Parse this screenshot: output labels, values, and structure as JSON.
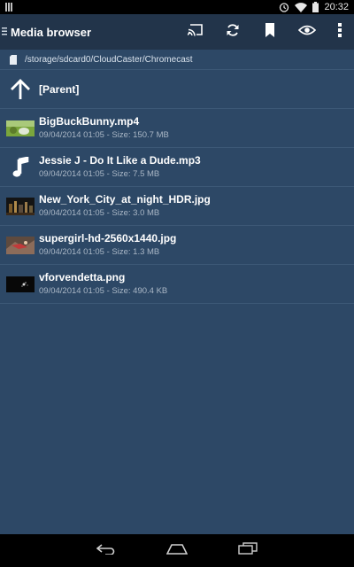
{
  "status_bar": {
    "time": "20:32",
    "icons": [
      "notification-icon",
      "alarm-icon",
      "wifi-icon",
      "battery-icon"
    ]
  },
  "action_bar": {
    "title": "Media browser",
    "actions": [
      "cast-icon",
      "refresh-icon",
      "bookmark-icon",
      "eye-icon",
      "overflow-menu-icon"
    ]
  },
  "path": {
    "text": "/storage/sdcard0/CloudCaster/Chromecast"
  },
  "parent": {
    "label": "[Parent]"
  },
  "files": [
    {
      "name": "BigBuckBunny.mp4",
      "meta": "09/04/2014 01:05 - Size: 150.7 MB",
      "type": "video"
    },
    {
      "name": "Jessie J - Do It Like a Dude.mp3",
      "meta": "09/04/2014 01:05 - Size: 7.5 MB",
      "type": "audio"
    },
    {
      "name": "New_York_City_at_night_HDR.jpg",
      "meta": "09/04/2014 01:05 - Size: 3.0 MB",
      "type": "image"
    },
    {
      "name": "supergirl-hd-2560x1440.jpg",
      "meta": "09/04/2014 01:05 - Size: 1.3 MB",
      "type": "image"
    },
    {
      "name": "vforvendetta.png",
      "meta": "09/04/2014 01:05 - Size: 490.4 KB",
      "type": "image"
    }
  ],
  "nav_bar": {
    "buttons": [
      "back-icon",
      "home-icon",
      "recents-icon"
    ]
  },
  "colors": {
    "background": "#2d4866",
    "action_bar": "#22344a",
    "divider": "#3c5876",
    "meta_text": "#aab7c6"
  }
}
